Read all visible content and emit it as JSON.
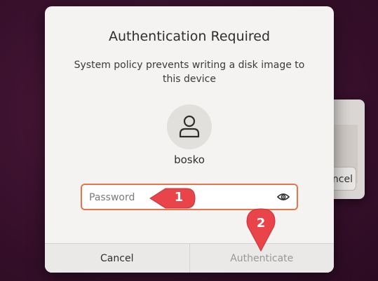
{
  "dialog": {
    "title": "Authentication Required",
    "message": "System policy prevents writing a disk image to this device",
    "username": "bosko",
    "password_placeholder": "Password",
    "cancel_label": "Cancel",
    "authenticate_label": "Authenticate"
  },
  "background_window": {
    "cancel_label": "ncel"
  },
  "annotations": {
    "callout1": "1",
    "callout2": "2"
  },
  "colors": {
    "accent": "#e9744b",
    "callout": "#e8444a"
  },
  "icons": {
    "avatar": "user-icon",
    "reveal": "eye-icon"
  }
}
